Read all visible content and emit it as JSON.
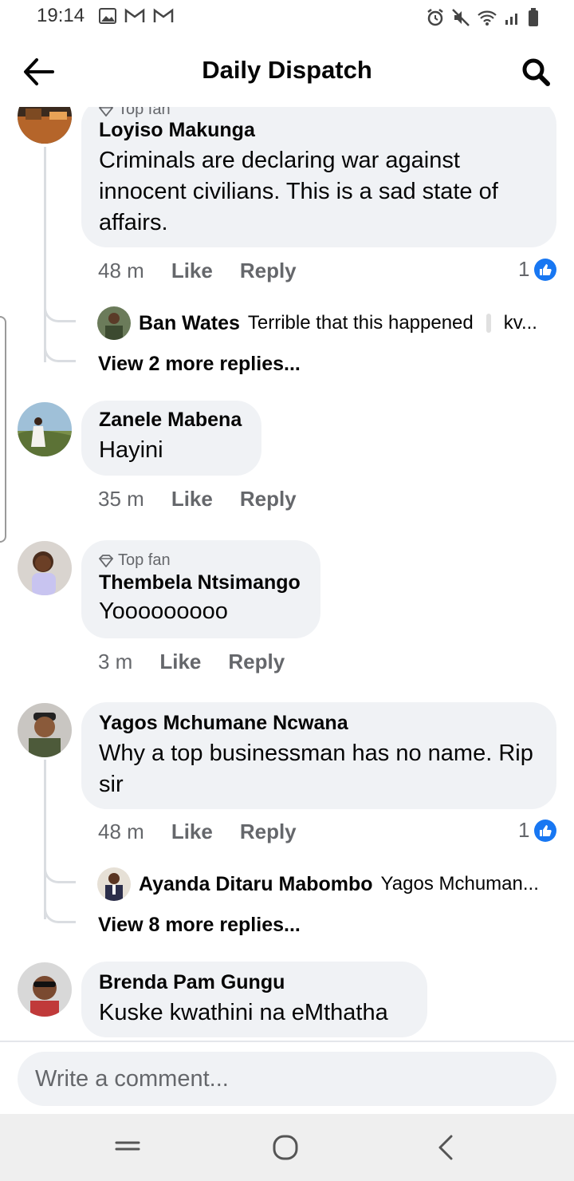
{
  "status_bar": {
    "time": "19:14"
  },
  "header": {
    "title": "Daily Dispatch"
  },
  "comments": [
    {
      "badge": "Top fan",
      "name": "Loyiso Makunga",
      "text": "Criminals are declaring war against innocent civilians. This is a sad state of affairs.",
      "time": "48 m",
      "like": "Like",
      "reply": "Reply",
      "reactions": "1",
      "reply_preview": {
        "name": "Ban Wates",
        "text": "Terrible that this happened",
        "trail": "kv..."
      },
      "view_more": "View 2 more replies..."
    },
    {
      "name": "Zanele Mabena",
      "text": "Hayini",
      "time": "35 m",
      "like": "Like",
      "reply": "Reply"
    },
    {
      "badge": "Top fan",
      "name": "Thembela Ntsimango",
      "text": "Yooooooooo",
      "time": "3 m",
      "like": "Like",
      "reply": "Reply"
    },
    {
      "name": "Yagos Mchumane Ncwana",
      "text": "Why a top businessman has no name. Rip sir",
      "time": "48 m",
      "like": "Like",
      "reply": "Reply",
      "reactions": "1",
      "reply_preview": {
        "name": "Ayanda Ditaru Mabombo",
        "text": "Yagos Mchuman..."
      },
      "view_more": "View 8 more replies..."
    },
    {
      "name": "Brenda Pam Gungu",
      "text": "Kuske kwathini na eMthatha"
    }
  ],
  "composer": {
    "placeholder": "Write a comment..."
  },
  "colors": {
    "brand_blue": "#1877f2",
    "bubble": "#f0f2f5",
    "meta_gray": "#65676b"
  },
  "icons": [
    "back-arrow-icon",
    "search-icon",
    "top-fan-diamond-icon",
    "like-reaction-icon",
    "recents-icon",
    "home-icon",
    "back-nav-icon"
  ]
}
